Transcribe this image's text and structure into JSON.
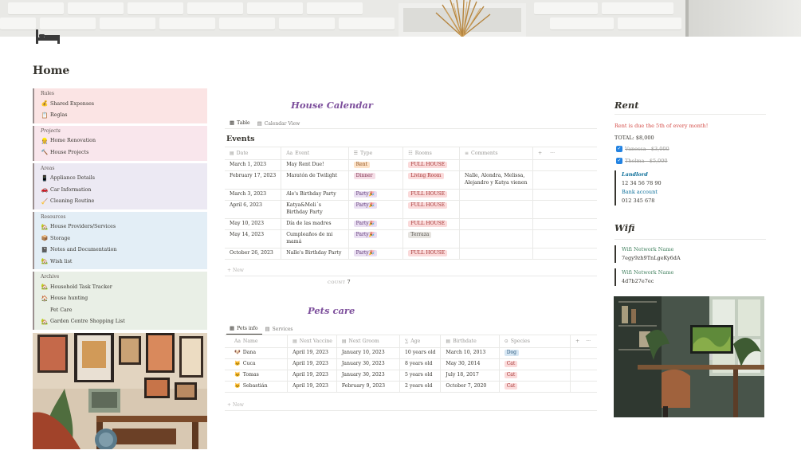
{
  "page": {
    "title": "Home",
    "icon": "bed-icon"
  },
  "sidebar": [
    {
      "title": "Rules",
      "italic": false,
      "bg": "#fbe4e4",
      "items": [
        {
          "icon": "💰",
          "label": "Shared Expenses"
        },
        {
          "icon": "📋",
          "label": "Reglas"
        }
      ]
    },
    {
      "title": "Projects",
      "italic": true,
      "bg": "#f9e6ec",
      "items": [
        {
          "icon": "👷",
          "label": "Home Renovation"
        },
        {
          "icon": "🔨",
          "label": "House Projects"
        }
      ]
    },
    {
      "title": "Areas",
      "italic": false,
      "bg": "#ece9f3",
      "items": [
        {
          "icon": "📱",
          "label": "Appliance Details"
        },
        {
          "icon": "🚗",
          "label": "Car Information"
        },
        {
          "icon": "🧹",
          "label": "Cleaning Routine"
        }
      ]
    },
    {
      "title": "Resources",
      "italic": false,
      "bg": "#e3eef6",
      "items": [
        {
          "icon": "🏡",
          "label": "House Providers/Services"
        },
        {
          "icon": "📦",
          "label": "Storage"
        },
        {
          "icon": "📓",
          "label": "Notes and Documentation"
        },
        {
          "icon": "🏡",
          "label": "Wish list"
        }
      ]
    },
    {
      "title": "Archive",
      "italic": false,
      "bg": "#e9efe6",
      "items": [
        {
          "icon": "🏡",
          "label": "Household Task Tracker"
        },
        {
          "icon": "🏠",
          "label": "House hunting"
        },
        {
          "icon": "",
          "label": "Pet Care"
        },
        {
          "icon": "🏡",
          "label": "Garden Centre Shopping List"
        }
      ]
    }
  ],
  "calendar": {
    "heading": "House Calendar",
    "views": [
      {
        "icon": "▦",
        "label": "Table"
      },
      {
        "icon": "▤",
        "label": "Calendar View"
      }
    ],
    "db_title": "Events",
    "columns": [
      {
        "icon": "▤",
        "label": "Date"
      },
      {
        "icon": "Aa",
        "label": "Event"
      },
      {
        "icon": "☰",
        "label": "Type"
      },
      {
        "icon": "☷",
        "label": "Rooms"
      },
      {
        "icon": "≡",
        "label": "Comments"
      }
    ],
    "rows": [
      {
        "date": "March 1, 2023",
        "event": "May Rent Due!",
        "type": "Rent",
        "type_class": "t-rent",
        "room": "FULL HOUSE",
        "room_class": "t-full",
        "comments": ""
      },
      {
        "date": "February 17, 2023",
        "event": "Maratón de Twilight",
        "type": "Dinner",
        "type_class": "t-dinner",
        "room": "Living Room",
        "room_class": "t-living",
        "comments": "Nalle, Alondra, Melissa, Alejandro y Katya vienen"
      },
      {
        "date": "March 3, 2023",
        "event": "Ale's Birthday Party",
        "type": "Party🎉",
        "type_class": "t-party",
        "room": "FULL HOUSE",
        "room_class": "t-full",
        "comments": ""
      },
      {
        "date": "April 6, 2023",
        "event": "Katya&Meli´s Birthday Party",
        "type": "Party🎉",
        "type_class": "t-party",
        "room": "FULL HOUSE",
        "room_class": "t-full",
        "comments": ""
      },
      {
        "date": "May 10, 2023",
        "event": "Día de las madres",
        "type": "Party🎉",
        "type_class": "t-party",
        "room": "FULL HOUSE",
        "room_class": "t-full",
        "comments": ""
      },
      {
        "date": "May 14, 2023",
        "event": "Cumpleaños de mi mamá",
        "type": "Party🎉",
        "type_class": "t-party",
        "room": "Terraza",
        "room_class": "t-terraza",
        "comments": ""
      },
      {
        "date": "October 26, 2023",
        "event": "Nalle's Birthday Party",
        "type": "Party🎉",
        "type_class": "t-party",
        "room": "FULL HOUSE",
        "room_class": "t-full",
        "comments": ""
      }
    ],
    "new_label": "New",
    "count_label": "COUNT",
    "count_value": "7"
  },
  "pets": {
    "heading": "Pets care",
    "views": [
      {
        "icon": "▦",
        "label": "Pets info"
      },
      {
        "icon": "▤",
        "label": "Services"
      }
    ],
    "columns": [
      {
        "icon": "Aa",
        "label": "Name"
      },
      {
        "icon": "▤",
        "label": "Next Vaccine"
      },
      {
        "icon": "▤",
        "label": "Next Groom"
      },
      {
        "icon": "∑",
        "label": "Age"
      },
      {
        "icon": "▤",
        "label": "Birthdate"
      },
      {
        "icon": "⊙",
        "label": "Species"
      }
    ],
    "rows": [
      {
        "icon": "🐶",
        "name": "Dana",
        "vaccine": "April 19, 2023",
        "groom": "January 10, 2023",
        "age": "10 years old",
        "birth": "March 10, 2013",
        "species": "Dog",
        "species_class": "t-dog"
      },
      {
        "icon": "🐱",
        "name": "Cuca",
        "vaccine": "April 19, 2023",
        "groom": "January 30, 2023",
        "age": "8 years old",
        "birth": "May 30, 2014",
        "species": "Cat",
        "species_class": "t-cat"
      },
      {
        "icon": "🐱",
        "name": "Tomas",
        "vaccine": "April 19, 2023",
        "groom": "January 30, 2023",
        "age": "5 years old",
        "birth": "July 18, 2017",
        "species": "Cat",
        "species_class": "t-cat"
      },
      {
        "icon": "🐱",
        "name": "Sebastián",
        "vaccine": "April 19, 2023",
        "groom": "February 9, 2023",
        "age": "2 years old",
        "birth": "October 7, 2020",
        "species": "Cat",
        "species_class": "t-cat"
      }
    ],
    "new_label": "New"
  },
  "rent": {
    "heading": "Rent",
    "due": "Rent is due the 5th of every month!",
    "total": "TOTAL: $8,000",
    "checks": [
      "Vanessa - $3,000",
      "Thelma - $5,000"
    ],
    "landlord_label": "Landlord",
    "landlord_phone": "12 34 56 78 90",
    "bank_label": "Bank account",
    "bank_number": "012 345 678"
  },
  "wifi": {
    "heading": "Wifi",
    "networks": [
      {
        "label": "Wifi Network Name",
        "value": "7egy9zh9TnLgeKy6dA"
      },
      {
        "label": "Wifi Network Name",
        "value": "4d7b27e7ec"
      }
    ]
  },
  "ui": {
    "plus": "+",
    "more": "···"
  }
}
